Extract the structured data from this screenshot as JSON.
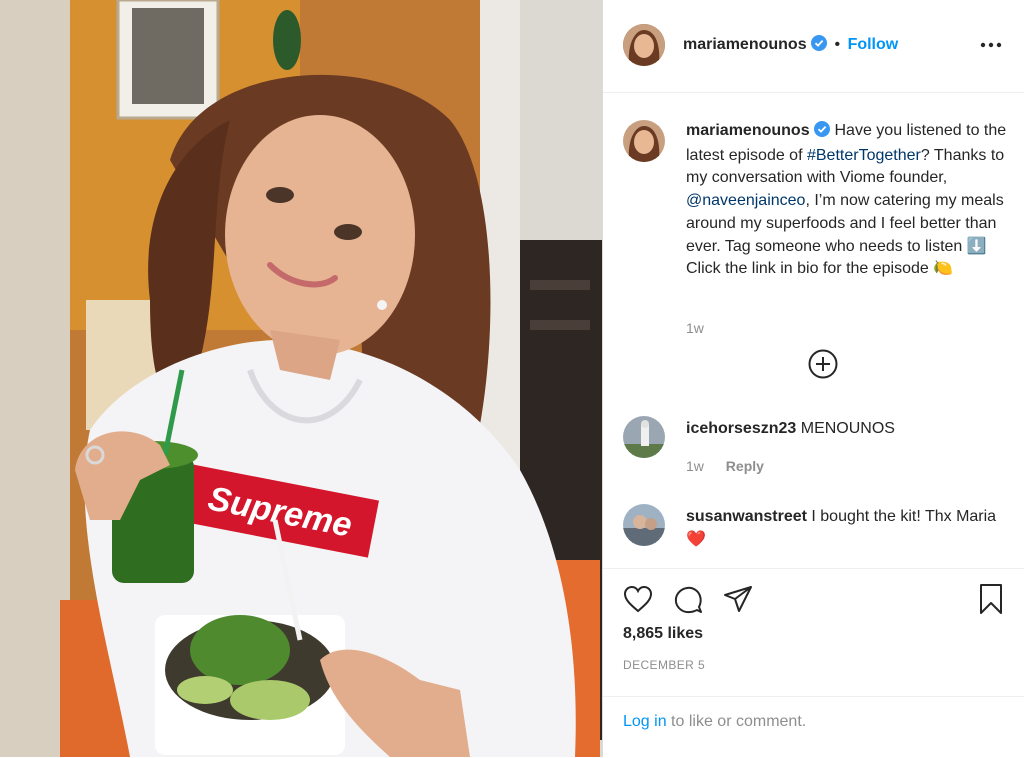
{
  "post": {
    "username": "mariamenounos",
    "follow_label": "Follow",
    "dot": "•",
    "caption": {
      "text_1": "Have you listened to the latest episode of",
      "hashtag": "#BetterTogether",
      "text_2": "? Thanks to my conversation with Viome founder,",
      "mention": "@naveenjainceo",
      "text_3": ", I’m now catering my meals around my superfoods and I feel better than ever. Tag someone who needs to listen",
      "emoji_down": "⬇️",
      "text_4": "Click the link in bio for the episode",
      "emoji_lemon": "🍋",
      "time": "1w"
    },
    "load_more_icon": "plus-circle-icon",
    "comments": [
      {
        "username": "icehorseszn23",
        "text": "MENOUNOS",
        "time": "1w",
        "reply_label": "Reply"
      },
      {
        "username": "susanwanstreet",
        "text": "I bought the kit! Thx Maria",
        "emoji": "❤️"
      }
    ],
    "likes": "8,865 likes",
    "date": "DECEMBER 5",
    "login_link": "Log in",
    "login_rest": "to like or comment.",
    "icons": {
      "like": "heart-icon",
      "comment": "comment-icon",
      "share": "share-icon",
      "save": "bookmark-icon",
      "more": "more-options-icon",
      "verified": "verified-badge-icon"
    },
    "photo_text": "Supreme"
  },
  "colors": {
    "link": "#0095f6",
    "verified": "#3897f0",
    "text": "#262626",
    "muted": "#8e8e8e"
  }
}
